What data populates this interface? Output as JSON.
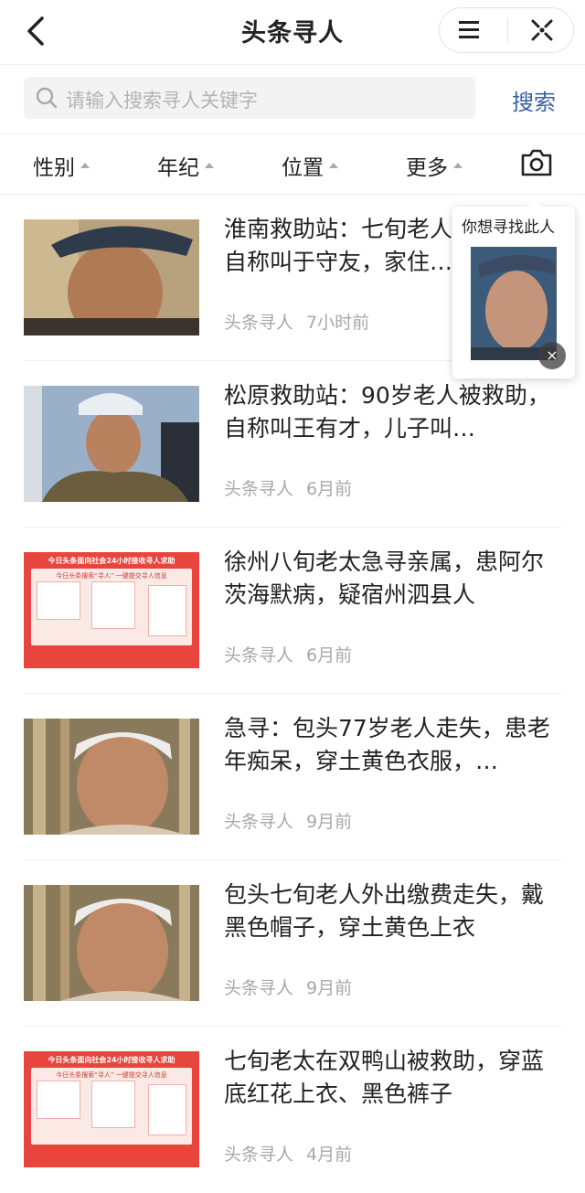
{
  "header": {
    "title": "头条寻人",
    "back_icon": "chevron-left-icon",
    "menu_icon": "hamburger-icon",
    "close_icon": "close-icon"
  },
  "search": {
    "placeholder": "请输入搜索寻人关键字",
    "button_label": "搜索"
  },
  "filters": [
    {
      "label": "性别"
    },
    {
      "label": "年纪"
    },
    {
      "label": "位置"
    },
    {
      "label": "更多"
    }
  ],
  "camera_icon": "camera-icon",
  "popup": {
    "label": "你想寻找此人",
    "close_glyph": "×"
  },
  "poster": {
    "banner": "今日头条面向社会24小时接收寻人求助",
    "sub": "今日头条搜索“寻人” 一键提交寻人信息"
  },
  "items": [
    {
      "title": "淮南救助站：七旬老人被救助，自称叫于守友，家住…",
      "source": "头条寻人",
      "time": "7小时前"
    },
    {
      "title": "松原救助站：90岁老人被救助，自称叫王有才，儿子叫…",
      "source": "头条寻人",
      "time": "6月前"
    },
    {
      "title": "徐州八旬老太急寻亲属，患阿尔茨海默病，疑宿州泗县人",
      "source": "头条寻人",
      "time": "6月前"
    },
    {
      "title": "急寻：包头77岁老人走失，患老年痴呆，穿土黄色衣服，…",
      "source": "头条寻人",
      "time": "9月前"
    },
    {
      "title": "包头七旬老人外出缴费走失，戴黑色帽子，穿土黄色上衣",
      "source": "头条寻人",
      "time": "9月前"
    },
    {
      "title": "七旬老太在双鸭山被救助，穿蓝底红花上衣、黑色裤子",
      "source": "头条寻人",
      "time": "4月前"
    }
  ],
  "colors": {
    "accent_blue": "#3b5fa3",
    "poster_red": "#e8453c"
  }
}
